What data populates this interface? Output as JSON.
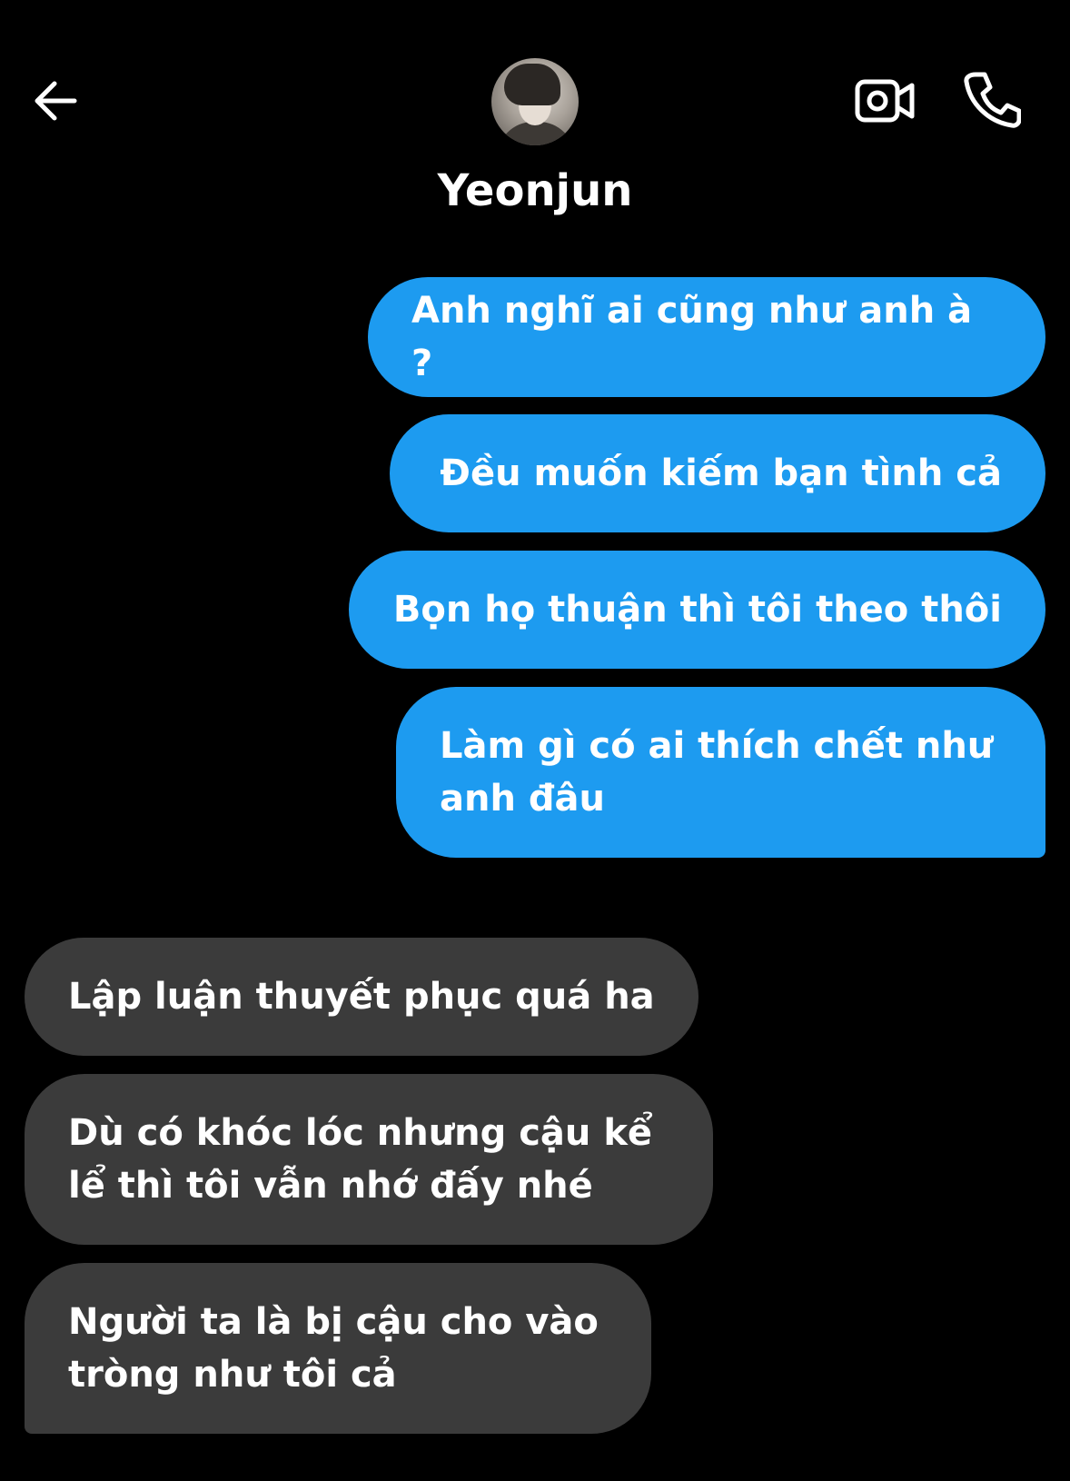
{
  "header": {
    "contact_name": "Yeonjun",
    "back_icon": "arrow-left-icon",
    "video_icon": "video-call-icon",
    "phone_icon": "phone-icon"
  },
  "colors": {
    "background": "#000000",
    "outgoing_bubble": "#1d9bf0",
    "incoming_bubble": "#3b3b3b",
    "text": "#ffffff"
  },
  "messages": {
    "outgoing": [
      "Anh nghĩ ai cũng như anh à ?",
      "Đều muốn kiếm bạn tình cả",
      "Bọn họ thuận thì tôi theo thôi",
      "Làm gì có ai thích chết như anh đâu"
    ],
    "incoming": [
      "Lập luận thuyết phục quá ha",
      "Dù có khóc lóc nhưng cậu kể lể thì tôi vẫn nhớ đấy nhé",
      "Người ta là bị cậu cho vào tròng như tôi cả"
    ]
  }
}
